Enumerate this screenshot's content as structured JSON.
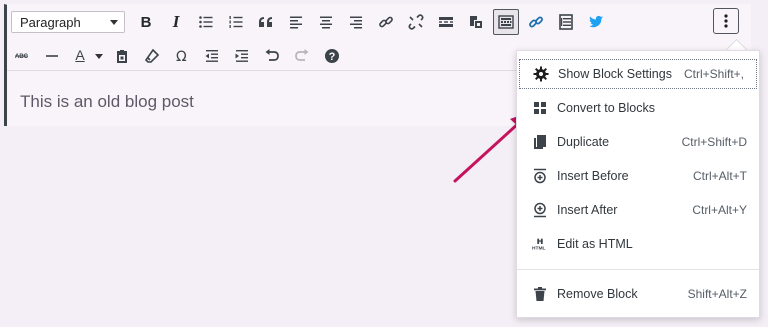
{
  "toolbar": {
    "format_select": {
      "value": "Paragraph"
    },
    "bold": "B",
    "italic": "I",
    "text_color": "A"
  },
  "content": {
    "text": "This is an old blog post"
  },
  "menu": {
    "items": [
      {
        "label": "Show Block Settings",
        "shortcut": "Ctrl+Shift+,",
        "icon": "gear-icon"
      },
      {
        "label": "Convert to Blocks",
        "shortcut": "",
        "icon": "grid-icon"
      },
      {
        "label": "Duplicate",
        "shortcut": "Ctrl+Shift+D",
        "icon": "copy-icon"
      },
      {
        "label": "Insert Before",
        "shortcut": "Ctrl+Alt+T",
        "icon": "insert-before-icon"
      },
      {
        "label": "Insert After",
        "shortcut": "Ctrl+Alt+Y",
        "icon": "insert-after-icon"
      },
      {
        "label": "Edit as HTML",
        "shortcut": "",
        "icon": "html-icon"
      },
      {
        "label": "Remove Block",
        "shortcut": "Shift+Alt+Z",
        "icon": "trash-icon"
      }
    ]
  },
  "colors": {
    "accent_arrow": "#c5135e",
    "twitter": "#1da1f2",
    "link": "#2271b1"
  }
}
